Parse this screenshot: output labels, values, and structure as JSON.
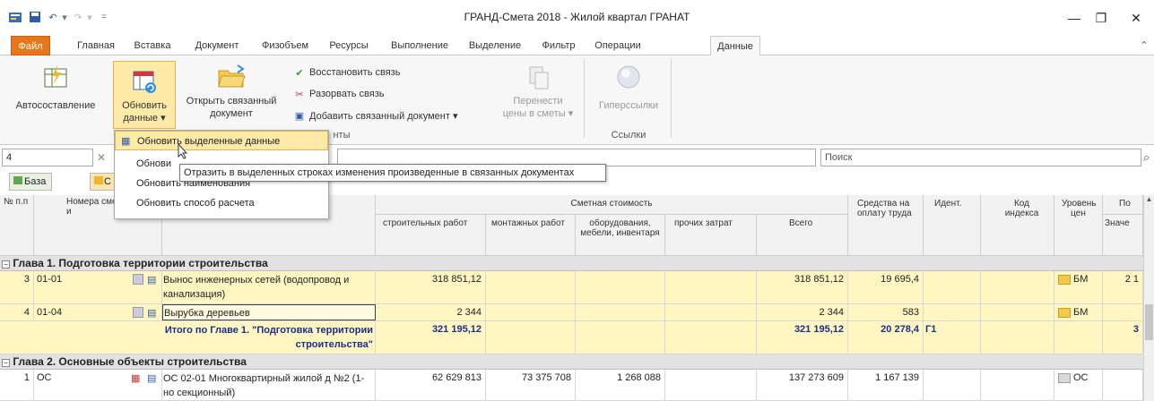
{
  "window": {
    "title": "ГРАНД-Смета 2018 - Жилой квартал ГРАНАТ",
    "minimize_icon": "—",
    "restore_icon": "❐",
    "close_icon": "✕",
    "help_icon": "⌃"
  },
  "tabs": [
    {
      "label": "Файл"
    },
    {
      "label": "Главная"
    },
    {
      "label": "Вставка"
    },
    {
      "label": "Документ"
    },
    {
      "label": "Физобъем"
    },
    {
      "label": "Ресурсы"
    },
    {
      "label": "Выполнение"
    },
    {
      "label": "Выделение"
    },
    {
      "label": "Фильтр"
    },
    {
      "label": "Операции"
    },
    {
      "label": "Данные"
    }
  ],
  "ribbon": {
    "autosostav": "Автосоставление",
    "update_data_1": "Обновить",
    "update_data_2": "данные ▾",
    "open_linked_1": "Открыть связанный",
    "open_linked_2": "документ",
    "restore_link": "Восстановить связь",
    "break_link": "Разорвать связь",
    "add_linked": "Добавить связанный документ  ▾",
    "transfer_1": "Перенести",
    "transfer_2": "цены в сметы ▾",
    "hyperlinks": "Гиперссылки",
    "group_links": "Ссылки",
    "group_docs_fragment": "нты"
  },
  "dropdown": {
    "items": [
      {
        "label": "Обновить выделенные данные"
      },
      {
        "label": "Обнови"
      },
      {
        "label": "Обновить наименования"
      },
      {
        "label": "Обновить способ расчета"
      }
    ]
  },
  "tooltip": "Отразить в выделенных строках изменения произведенные в связанных документах",
  "filter": {
    "value": "4",
    "clear": "✕",
    "search_placeholder": "Поиск",
    "search_icon": "⌕"
  },
  "toolbar2": {
    "base_label": "База",
    "other_label": "С"
  },
  "grid": {
    "headers": {
      "num": "№ п.п",
      "codes": "Номера сме расчетов и",
      "name_fragment": "т",
      "estimate_cost": "Сметная стоимость",
      "construction": "строительных работ",
      "montage": "монтажных работ",
      "equipment": "оборудования, мебели, инвентаря",
      "other": "прочих затрат",
      "total": "Всего",
      "wages": "Средства на оплату труда",
      "ident": "Идент.",
      "index_code": "Код индекса",
      "price_level": "Уровень цен",
      "po": "По",
      "value_fragment": "Значе"
    },
    "chapter1": "Глава 1. Подготовка территории строительства",
    "rows": [
      {
        "num": "3",
        "code": "01-01",
        "name": "Вынос инженерных сетей (водопровод и канализация)",
        "construction": "318 851,12",
        "total": "318 851,12",
        "wages": "19 695,4",
        "level": "БМ",
        "extra": "2 1"
      },
      {
        "num": "4",
        "code": "01-04",
        "name": "Вырубка деревьев",
        "construction": "2 344",
        "total": "2 344",
        "wages": "583",
        "level": "БМ",
        "extra": ""
      }
    ],
    "total1": {
      "label": "Итого по Главе 1. \"Подготовка территории строительства\"",
      "construction": "321 195,12",
      "total": "321 195,12",
      "wages": "20 278,4",
      "ident": "Г1",
      "extra": "3"
    },
    "chapter2": "Глава 2. Основные объекты строительства",
    "row_oc": {
      "num": "1",
      "code": "ОС",
      "name": "ОС 02-01 Многоквартирный жилой д №2 (1-но секционный)",
      "construction": "62 629 813",
      "montage": "73 375 708",
      "equipment": "1 268 088",
      "total": "137 273 609",
      "wages": "1 167 139",
      "level": "ОС"
    }
  },
  "colors": {
    "file_tab": "#e8771b",
    "highlight": "#fde9a8",
    "row_yellow": "#fff6c2",
    "total_text": "#1a2e8a"
  }
}
